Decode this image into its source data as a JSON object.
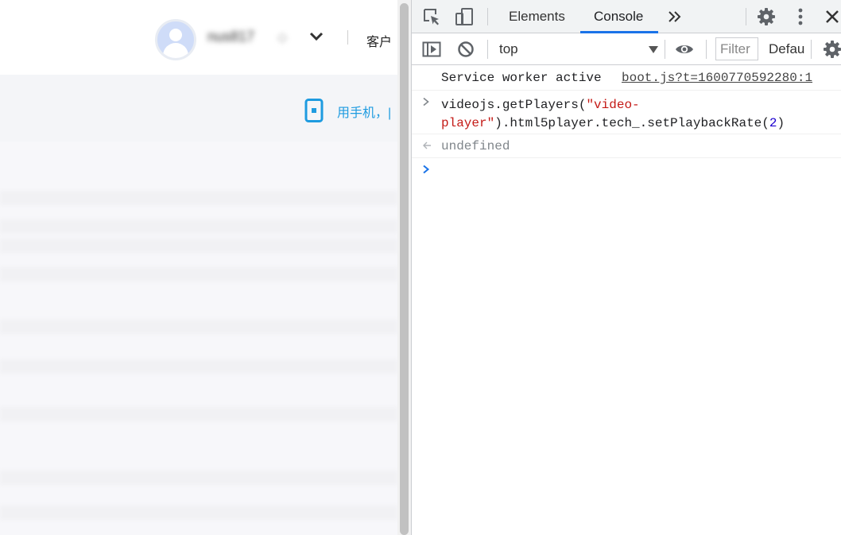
{
  "page": {
    "username": "nus817",
    "diamond_glyph": "◇",
    "client_label": "客户",
    "phone_label": "用手机，|"
  },
  "devtools": {
    "tabs": [
      {
        "label": "Elements",
        "active": false
      },
      {
        "label": "Console",
        "active": true
      }
    ],
    "toolbar": {
      "context": "top",
      "filter_placeholder": "Filter",
      "levels_label": "Default levels"
    },
    "console": {
      "message": "Service worker active",
      "message_source": "boot.js?t=1600770592280:1",
      "command": {
        "part1": "videojs.getPlayers(",
        "string": "\"video-\nplayer\"",
        "part2": ").html5player.tech_.setPlaybackRate(",
        "number": "2",
        "part3": ")"
      },
      "return_value": "undefined"
    },
    "colors": {
      "active_tab_underline": "#1a73e8",
      "prompt": "#1a73e8",
      "string": "#c41a16",
      "number": "#1c00cf"
    }
  }
}
